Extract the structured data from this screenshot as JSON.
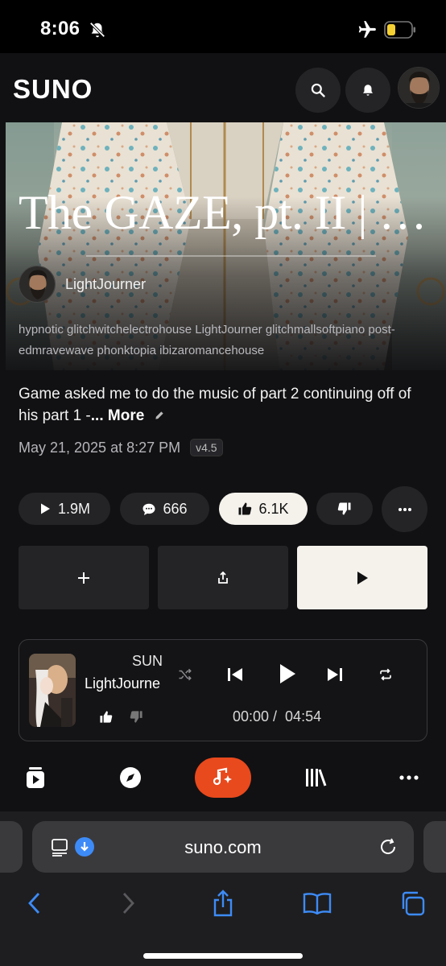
{
  "status_bar": {
    "time": "8:06"
  },
  "app": {
    "logo": "SUNO",
    "icons": {
      "search": "search-icon",
      "notifications": "bell-icon"
    }
  },
  "song": {
    "title": "The GAZE, pt. II | Ga...",
    "creator": "LightJourner",
    "tags": "hypnotic glitchwitchelectrohouse LightJourner glitchmallsoftpiano post-edmravewave phonktopia ibizaromancehouse",
    "description": "Game asked me to do the music of part 2 continuing off of his part 1 -",
    "more_label": "... More",
    "date": "May 21, 2025 at 8:27 PM",
    "version": "v4.5"
  },
  "stats": {
    "plays": "1.9M",
    "comments": "666",
    "likes": "6.1K"
  },
  "player": {
    "title": "SUN",
    "artist": "LightJourne",
    "time": "00:00 /  04:54"
  },
  "browser": {
    "url": "suno.com"
  },
  "colors": {
    "accent": "#e8491d",
    "light_button": "#f5f2ec",
    "panel": "#242427",
    "link_blue": "#3d8bf7"
  }
}
